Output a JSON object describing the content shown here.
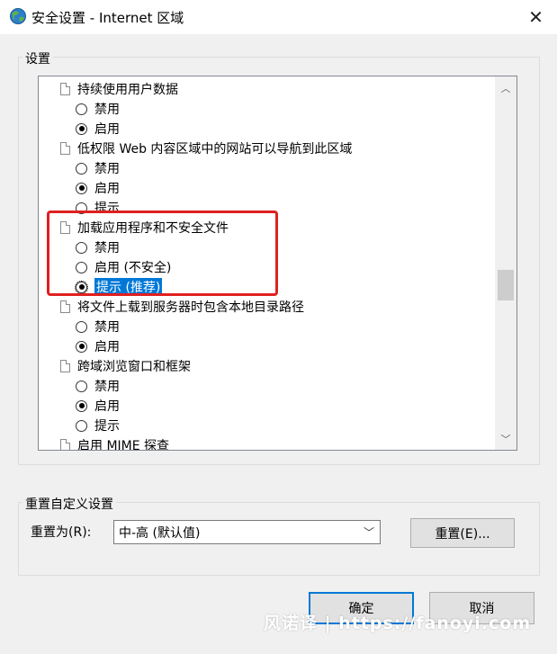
{
  "window": {
    "title": "安全设置 - Internet 区域"
  },
  "settings_group": {
    "label": "设置"
  },
  "list": {
    "items": [
      {
        "kind": "head",
        "label": "持续使用用户数据"
      },
      {
        "kind": "option",
        "label": "禁用",
        "checked": false
      },
      {
        "kind": "option",
        "label": "启用",
        "checked": true
      },
      {
        "kind": "head",
        "label": "低权限 Web 内容区域中的网站可以导航到此区域"
      },
      {
        "kind": "option",
        "label": "禁用",
        "checked": false
      },
      {
        "kind": "option",
        "label": "启用",
        "checked": true
      },
      {
        "kind": "option",
        "label": "提示",
        "checked": false
      },
      {
        "kind": "head",
        "label": "加载应用程序和不安全文件"
      },
      {
        "kind": "option",
        "label": "禁用",
        "checked": false
      },
      {
        "kind": "option",
        "label": "启用 (不安全)",
        "checked": false
      },
      {
        "kind": "option",
        "label": "提示 (推荐)",
        "checked": true,
        "selected": true
      },
      {
        "kind": "head",
        "label": "将文件上载到服务器时包含本地目录路径"
      },
      {
        "kind": "option",
        "label": "禁用",
        "checked": false
      },
      {
        "kind": "option",
        "label": "启用",
        "checked": true
      },
      {
        "kind": "head",
        "label": "跨域浏览窗口和框架"
      },
      {
        "kind": "option",
        "label": "禁用",
        "checked": false
      },
      {
        "kind": "option",
        "label": "启用",
        "checked": true
      },
      {
        "kind": "option",
        "label": "提示",
        "checked": false
      },
      {
        "kind": "head",
        "label": "启用 MIME 探查"
      }
    ]
  },
  "reset_group": {
    "label": "重置自定义设置",
    "reset_to_label": "重置为(R):",
    "combo_value": "中-高 (默认值)",
    "reset_button": "重置(E)..."
  },
  "footer": {
    "ok": "确定",
    "cancel": "取消"
  },
  "watermark": "风诺译 | https://fanoyi.com",
  "colors": {
    "selection": "#0078d7",
    "highlight_box": "#e02020"
  }
}
